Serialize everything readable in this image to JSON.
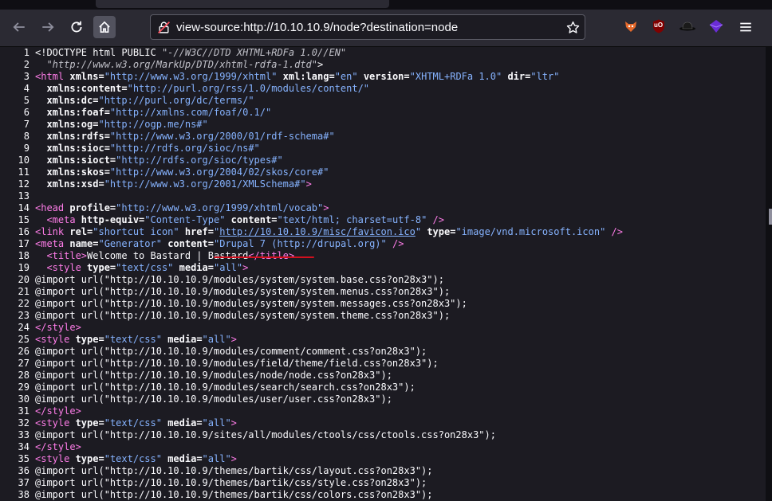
{
  "browser": {
    "url": "view-source:http://10.10.10.9/node?destination=node",
    "icons": {
      "back": "arrow-left-icon",
      "forward": "arrow-right-icon",
      "reload": "reload-icon",
      "home": "home-icon",
      "site": "not-secure-icon",
      "bookmark": "star-icon",
      "menu": "hamburger-icon"
    },
    "extensions": [
      "foxyproxy-icon",
      "ublock-origin-icon",
      "hat-icon",
      "purple-cube-icon"
    ],
    "ublock_badge": "uO"
  },
  "source_lines": [
    {
      "n": "1",
      "parts": [
        {
          "c": "",
          "t": "<!DOCTYPE html PUBLIC "
        },
        {
          "c": "c",
          "t": "\"-//W3C//DTD XHTML+RDFa 1.0//EN\""
        }
      ]
    },
    {
      "n": "2",
      "parts": [
        {
          "c": "c",
          "t": "  \"http://www.w3.org/MarkUp/DTD/xhtml-rdfa-1.dtd\""
        },
        {
          "c": "",
          "t": ">"
        }
      ]
    },
    {
      "n": "3",
      "parts": [
        {
          "c": "t",
          "t": "<html"
        },
        {
          "c": "a",
          "t": " xmlns="
        },
        {
          "c": "v",
          "t": "\"http://www.w3.org/1999/xhtml\""
        },
        {
          "c": "a",
          "t": " xml:lang="
        },
        {
          "c": "v",
          "t": "\"en\""
        },
        {
          "c": "a",
          "t": " version="
        },
        {
          "c": "v",
          "t": "\"XHTML+RDFa 1.0\""
        },
        {
          "c": "a",
          "t": " dir="
        },
        {
          "c": "v",
          "t": "\"ltr\""
        }
      ]
    },
    {
      "n": "4",
      "parts": [
        {
          "c": "a",
          "t": "  xmlns:content="
        },
        {
          "c": "v",
          "t": "\"http://purl.org/rss/1.0/modules/content/\""
        }
      ]
    },
    {
      "n": "5",
      "parts": [
        {
          "c": "a",
          "t": "  xmlns:dc="
        },
        {
          "c": "v",
          "t": "\"http://purl.org/dc/terms/\""
        }
      ]
    },
    {
      "n": "6",
      "parts": [
        {
          "c": "a",
          "t": "  xmlns:foaf="
        },
        {
          "c": "v",
          "t": "\"http://xmlns.com/foaf/0.1/\""
        }
      ]
    },
    {
      "n": "7",
      "parts": [
        {
          "c": "a",
          "t": "  xmlns:og="
        },
        {
          "c": "v",
          "t": "\"http://ogp.me/ns#\""
        }
      ]
    },
    {
      "n": "8",
      "parts": [
        {
          "c": "a",
          "t": "  xmlns:rdfs="
        },
        {
          "c": "v",
          "t": "\"http://www.w3.org/2000/01/rdf-schema#\""
        }
      ]
    },
    {
      "n": "9",
      "parts": [
        {
          "c": "a",
          "t": "  xmlns:sioc="
        },
        {
          "c": "v",
          "t": "\"http://rdfs.org/sioc/ns#\""
        }
      ]
    },
    {
      "n": "10",
      "parts": [
        {
          "c": "a",
          "t": "  xmlns:sioct="
        },
        {
          "c": "v",
          "t": "\"http://rdfs.org/sioc/types#\""
        }
      ]
    },
    {
      "n": "11",
      "parts": [
        {
          "c": "a",
          "t": "  xmlns:skos="
        },
        {
          "c": "v",
          "t": "\"http://www.w3.org/2004/02/skos/core#\""
        }
      ]
    },
    {
      "n": "12",
      "parts": [
        {
          "c": "a",
          "t": "  xmlns:xsd="
        },
        {
          "c": "v",
          "t": "\"http://www.w3.org/2001/XMLSchema#\""
        },
        {
          "c": "t",
          "t": ">"
        }
      ]
    },
    {
      "n": "13",
      "parts": []
    },
    {
      "n": "14",
      "parts": [
        {
          "c": "t",
          "t": "<head"
        },
        {
          "c": "a",
          "t": " profile="
        },
        {
          "c": "v",
          "t": "\"http://www.w3.org/1999/xhtml/vocab\""
        },
        {
          "c": "t",
          "t": ">"
        }
      ]
    },
    {
      "n": "15",
      "parts": [
        {
          "c": "t",
          "t": "  <meta"
        },
        {
          "c": "a",
          "t": " http-equiv="
        },
        {
          "c": "v",
          "t": "\"Content-Type\""
        },
        {
          "c": "a",
          "t": " content="
        },
        {
          "c": "v",
          "t": "\"text/html; charset=utf-8\""
        },
        {
          "c": "t",
          "t": " />"
        }
      ]
    },
    {
      "n": "16",
      "parts": [
        {
          "c": "t",
          "t": "<link"
        },
        {
          "c": "a",
          "t": " rel="
        },
        {
          "c": "v",
          "t": "\"shortcut icon\""
        },
        {
          "c": "a",
          "t": " href="
        },
        {
          "c": "v",
          "t": "\""
        },
        {
          "c": "lk",
          "t": "http://10.10.10.9/misc/favicon.ico"
        },
        {
          "c": "v",
          "t": "\""
        },
        {
          "c": "a",
          "t": " type="
        },
        {
          "c": "v",
          "t": "\"image/vnd.microsoft.icon\""
        },
        {
          "c": "t",
          "t": " />"
        }
      ]
    },
    {
      "n": "17",
      "parts": [
        {
          "c": "t",
          "t": "<meta"
        },
        {
          "c": "a",
          "t": " name="
        },
        {
          "c": "v",
          "t": "\"Generator\""
        },
        {
          "c": "a",
          "t": " content="
        },
        {
          "c": "v",
          "t": "\"Drupal 7 (http://drupal.org)\""
        },
        {
          "c": "t",
          "t": " />"
        }
      ]
    },
    {
      "n": "18",
      "parts": [
        {
          "c": "t",
          "t": "  <title"
        },
        {
          "c": "t",
          "t": ">"
        },
        {
          "c": "",
          "t": "Welcome to Bastard | Bastard"
        },
        {
          "c": "t",
          "t": "</title>"
        }
      ]
    },
    {
      "n": "19",
      "parts": [
        {
          "c": "t",
          "t": "  <style"
        },
        {
          "c": "a",
          "t": " type="
        },
        {
          "c": "v",
          "t": "\"text/css\""
        },
        {
          "c": "a",
          "t": " media="
        },
        {
          "c": "v",
          "t": "\"all\""
        },
        {
          "c": "t",
          "t": ">"
        }
      ]
    },
    {
      "n": "20",
      "parts": [
        {
          "c": "",
          "t": "@import url(\"http://10.10.10.9/modules/system/system.base.css?on28x3\");"
        }
      ]
    },
    {
      "n": "21",
      "parts": [
        {
          "c": "",
          "t": "@import url(\"http://10.10.10.9/modules/system/system.menus.css?on28x3\");"
        }
      ]
    },
    {
      "n": "22",
      "parts": [
        {
          "c": "",
          "t": "@import url(\"http://10.10.10.9/modules/system/system.messages.css?on28x3\");"
        }
      ]
    },
    {
      "n": "23",
      "parts": [
        {
          "c": "",
          "t": "@import url(\"http://10.10.10.9/modules/system/system.theme.css?on28x3\");"
        }
      ]
    },
    {
      "n": "24",
      "parts": [
        {
          "c": "t",
          "t": "</style>"
        }
      ]
    },
    {
      "n": "25",
      "parts": [
        {
          "c": "t",
          "t": "<style"
        },
        {
          "c": "a",
          "t": " type="
        },
        {
          "c": "v",
          "t": "\"text/css\""
        },
        {
          "c": "a",
          "t": " media="
        },
        {
          "c": "v",
          "t": "\"all\""
        },
        {
          "c": "t",
          "t": ">"
        }
      ]
    },
    {
      "n": "26",
      "parts": [
        {
          "c": "",
          "t": "@import url(\"http://10.10.10.9/modules/comment/comment.css?on28x3\");"
        }
      ]
    },
    {
      "n": "27",
      "parts": [
        {
          "c": "",
          "t": "@import url(\"http://10.10.10.9/modules/field/theme/field.css?on28x3\");"
        }
      ]
    },
    {
      "n": "28",
      "parts": [
        {
          "c": "",
          "t": "@import url(\"http://10.10.10.9/modules/node/node.css?on28x3\");"
        }
      ]
    },
    {
      "n": "29",
      "parts": [
        {
          "c": "",
          "t": "@import url(\"http://10.10.10.9/modules/search/search.css?on28x3\");"
        }
      ]
    },
    {
      "n": "30",
      "parts": [
        {
          "c": "",
          "t": "@import url(\"http://10.10.10.9/modules/user/user.css?on28x3\");"
        }
      ]
    },
    {
      "n": "31",
      "parts": [
        {
          "c": "t",
          "t": "</style>"
        }
      ]
    },
    {
      "n": "32",
      "parts": [
        {
          "c": "t",
          "t": "<style"
        },
        {
          "c": "a",
          "t": " type="
        },
        {
          "c": "v",
          "t": "\"text/css\""
        },
        {
          "c": "a",
          "t": " media="
        },
        {
          "c": "v",
          "t": "\"all\""
        },
        {
          "c": "t",
          "t": ">"
        }
      ]
    },
    {
      "n": "33",
      "parts": [
        {
          "c": "",
          "t": "@import url(\"http://10.10.10.9/sites/all/modules/ctools/css/ctools.css?on28x3\");"
        }
      ]
    },
    {
      "n": "34",
      "parts": [
        {
          "c": "t",
          "t": "</style>"
        }
      ]
    },
    {
      "n": "35",
      "parts": [
        {
          "c": "t",
          "t": "<style"
        },
        {
          "c": "a",
          "t": " type="
        },
        {
          "c": "v",
          "t": "\"text/css\""
        },
        {
          "c": "a",
          "t": " media="
        },
        {
          "c": "v",
          "t": "\"all\""
        },
        {
          "c": "t",
          "t": ">"
        }
      ]
    },
    {
      "n": "36",
      "parts": [
        {
          "c": "",
          "t": "@import url(\"http://10.10.10.9/themes/bartik/css/layout.css?on28x3\");"
        }
      ]
    },
    {
      "n": "37",
      "parts": [
        {
          "c": "",
          "t": "@import url(\"http://10.10.10.9/themes/bartik/css/style.css?on28x3\");"
        }
      ]
    },
    {
      "n": "38",
      "parts": [
        {
          "c": "",
          "t": "@import url(\"http://10.10.10.9/themes/bartik/css/colors.css?on28x3\");"
        }
      ]
    }
  ]
}
